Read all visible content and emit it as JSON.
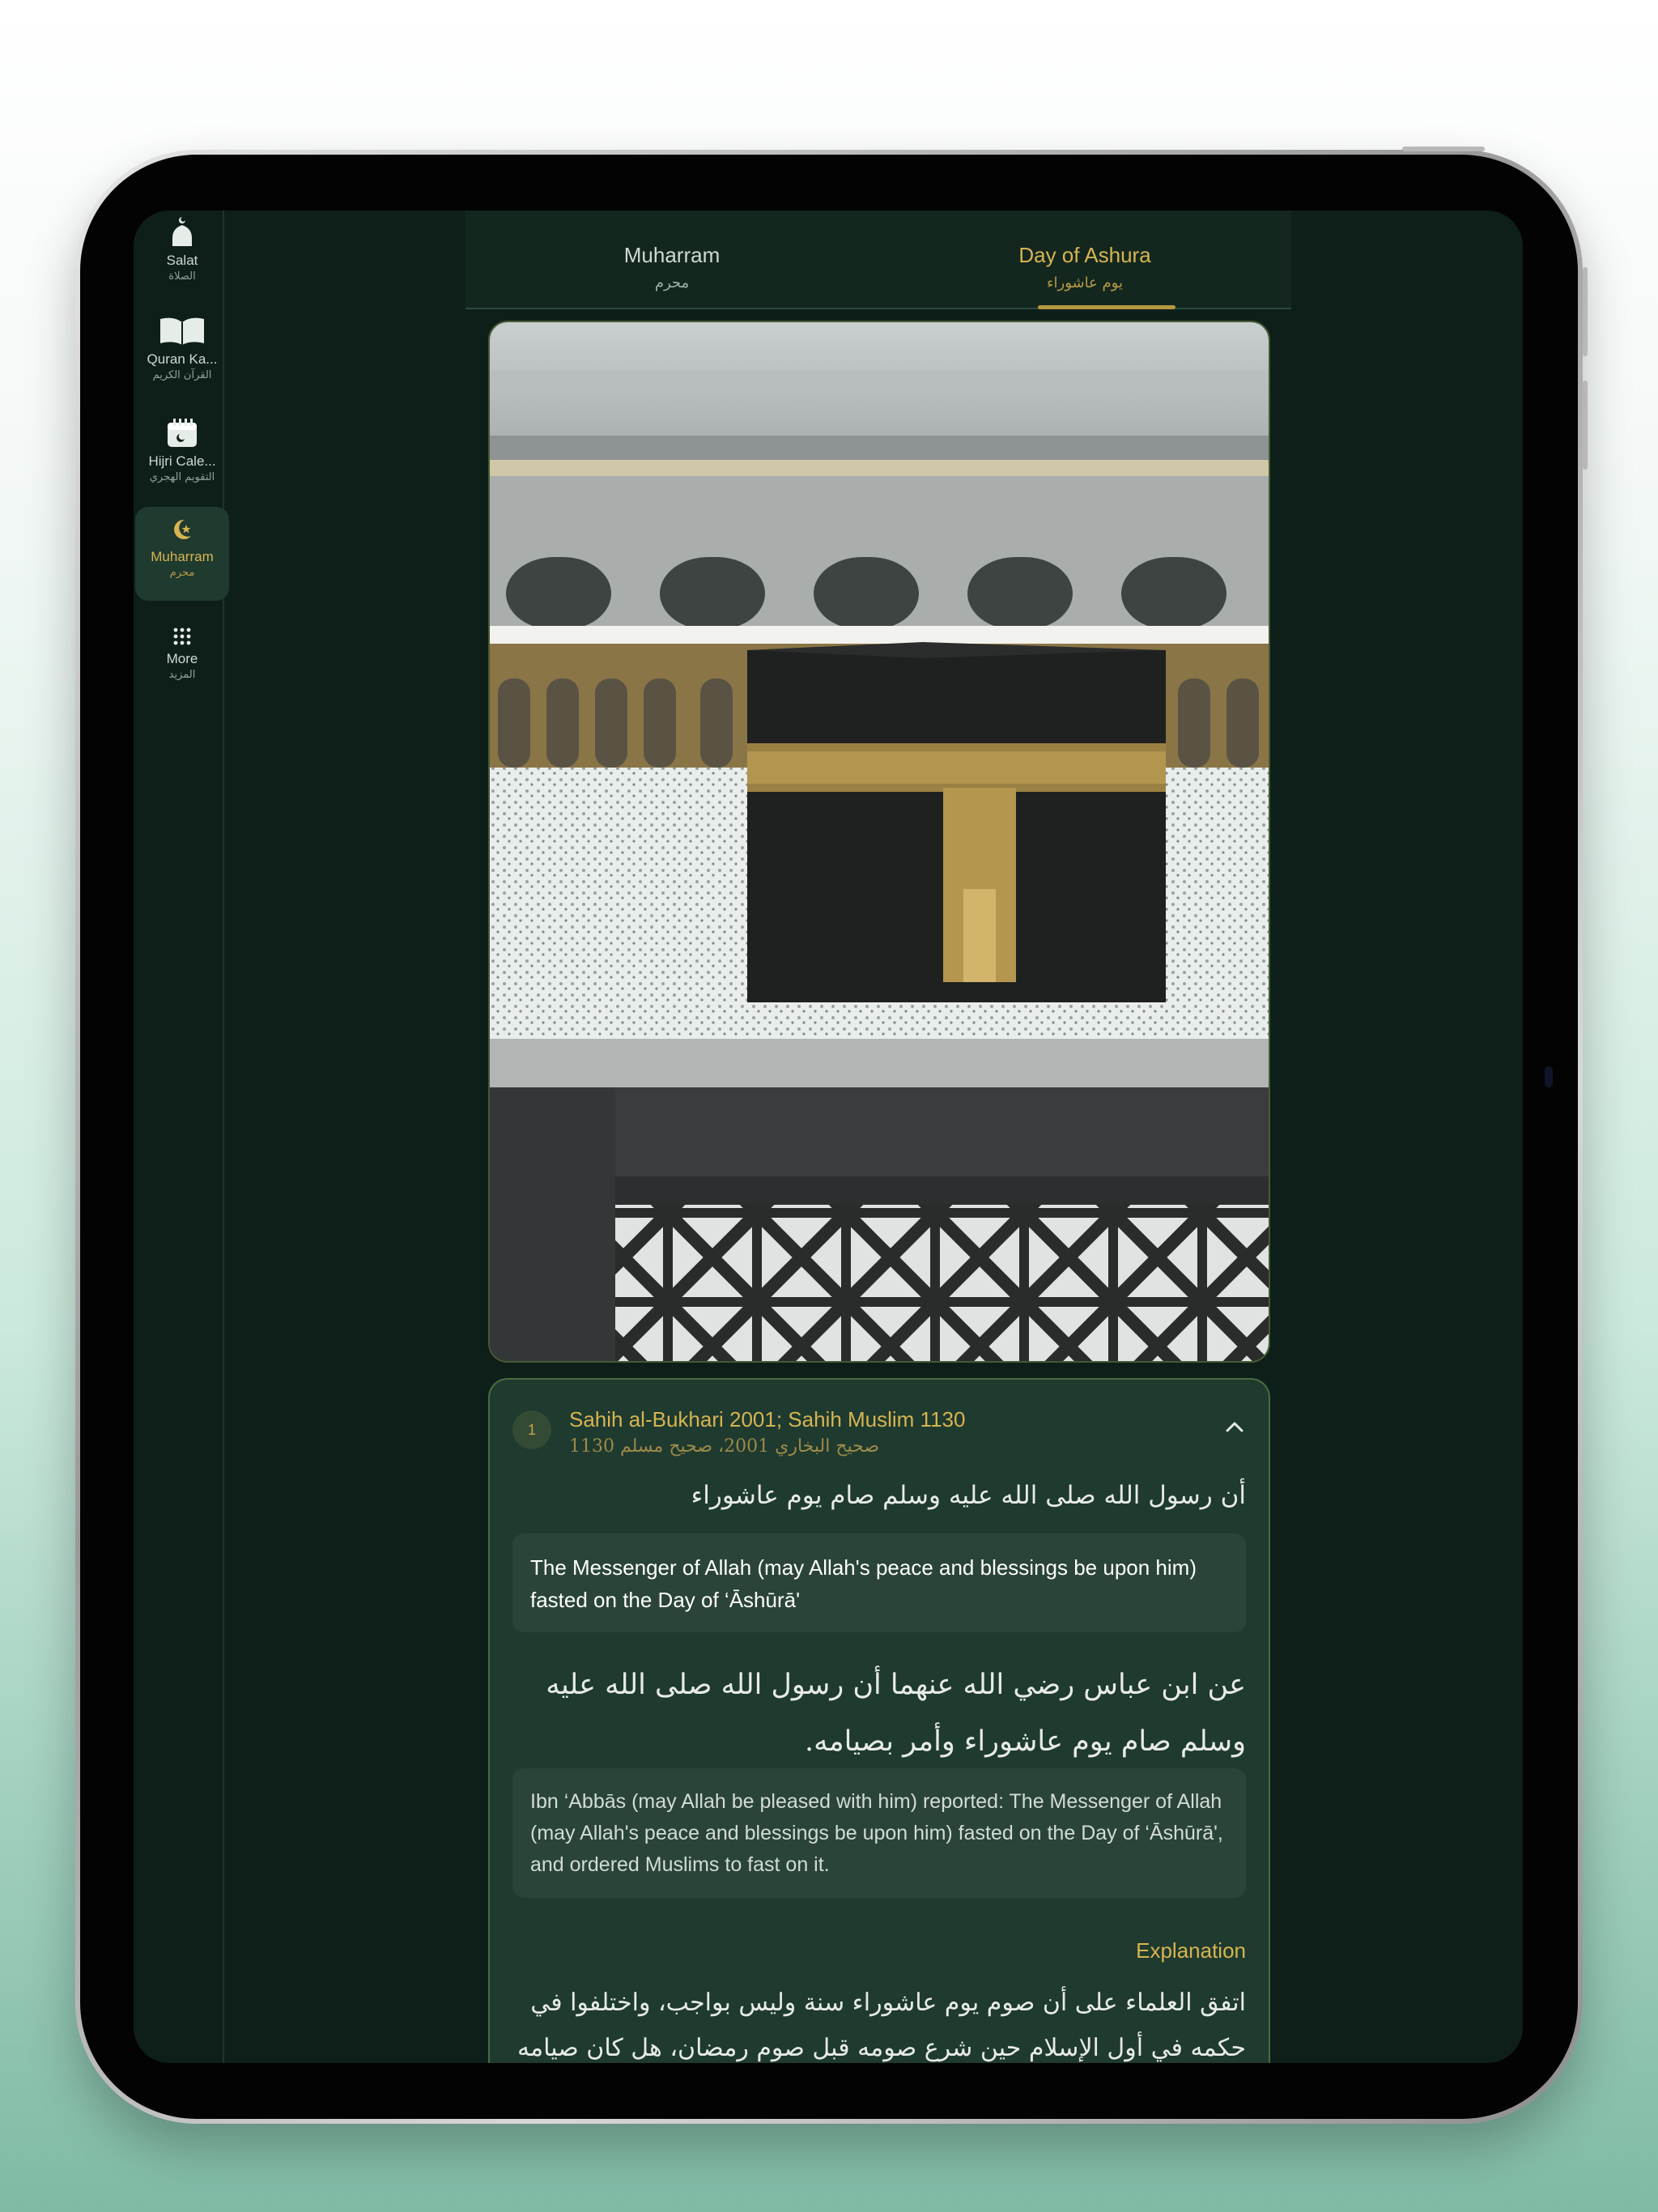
{
  "sidebar": {
    "items": [
      {
        "label": "Salat",
        "label_ar": "الصلاة",
        "icon": "mosque-icon",
        "active": false
      },
      {
        "label": "Quran Ka...",
        "label_ar": "القرآن الكريم",
        "icon": "quran-book-icon",
        "active": false
      },
      {
        "label": "Hijri Cale...",
        "label_ar": "التقويم الهجري",
        "icon": "calendar-icon",
        "active": false
      },
      {
        "label": "Muharram",
        "label_ar": "محرم",
        "icon": "crescent-star-icon",
        "active": true
      },
      {
        "label": "More",
        "label_ar": "المزيد",
        "icon": "grid-dots-icon",
        "active": false
      }
    ]
  },
  "tabs": [
    {
      "label": "Muharram",
      "label_ar": "محرم",
      "active": false
    },
    {
      "label": "Day of Ashura",
      "label_ar": "يوم عاشوراء",
      "active": true
    }
  ],
  "card": {
    "number": "1",
    "source": "Sahih al-Bukhari 2001; Sahih Muslim 1130",
    "source_ar": "صحيح البخاري 2001، صحيح مسلم 1130",
    "short_arabic": "أن رسول الله صلى الله عليه وسلم صام يوم عاشوراء",
    "short_translation": "The Messenger of Allah (may Allah's peace and blessings be upon him) fasted on the Day of ‘Āshūrā'",
    "full_arabic": "عن ابن عباس رضي الله عنهما أن رسول الله صلى الله عليه وسلم صام يوم عاشوراء وأمر بصيامه.",
    "full_translation": "Ibn ‘Abbās (may Allah be pleased with him) reported: The Messenger of Allah (may Allah's peace and blessings be upon him) fasted on the Day of ‘Āshūrā', and ordered Muslims to fast on it.",
    "explanation_heading": "Explanation",
    "explanation_arabic": "اتفق العلماء على أن صوم يوم عاشوراء سنة وليس بواجب، واختلفوا في حكمه في أول الإسلام حين شرع صومه قبل صوم رمضان، هل كان صيامه واجباً أم لا؟، فعلى"
  },
  "colors": {
    "accent_gold": "#d7b451",
    "background": "#0e1f1a",
    "card": "#1f3a2f"
  }
}
